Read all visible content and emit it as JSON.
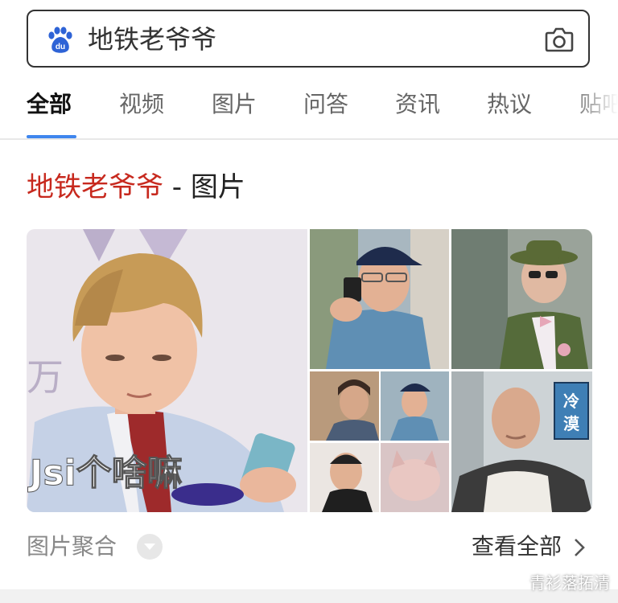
{
  "search": {
    "query": "地铁老爷爷",
    "logo_icon": "baidu-paw-icon",
    "camera_icon": "camera-icon"
  },
  "tabs": [
    {
      "label": "全部",
      "active": true
    },
    {
      "label": "视频"
    },
    {
      "label": "图片"
    },
    {
      "label": "问答"
    },
    {
      "label": "资讯"
    },
    {
      "label": "热议"
    },
    {
      "label": "贴吧"
    }
  ],
  "result": {
    "title_highlight": "地铁老爷爷",
    "title_rest": " - 图片",
    "big_image_caption": "Jsi个啥嘛",
    "sticker_text": "冷漠"
  },
  "footer": {
    "left_label": "图片聚合",
    "right_label": "查看全部"
  },
  "watermark": "青衫落拓清",
  "colors": {
    "accent_blue": "#3f86ee",
    "highlight_red": "#c7291e"
  }
}
